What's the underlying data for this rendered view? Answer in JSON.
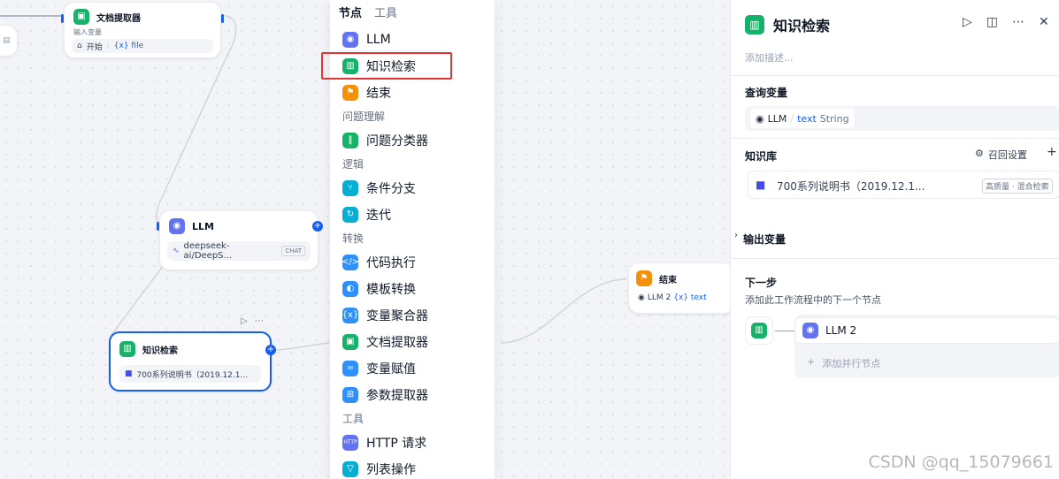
{
  "canvas": {
    "doc_extractor_node": {
      "title": "文档提取器",
      "subtitle": "输入变量",
      "input_source": "开始",
      "input_var": "{x} file"
    },
    "llm_node": {
      "title": "LLM",
      "model": "deepseek-ai/DeepS...",
      "badge": "CHAT"
    },
    "knowledge_node": {
      "title": "知识检索",
      "dataset": "700系列说明书（2019.12.1..."
    },
    "end_node": {
      "title": "结束",
      "source": "LLM 2",
      "var": "{x} text"
    }
  },
  "menu": {
    "tabs": [
      "节点",
      "工具"
    ],
    "items_top": [
      {
        "label": "LLM",
        "icon": "brain-icon"
      },
      {
        "label": "知识检索",
        "icon": "book-icon"
      },
      {
        "label": "结束",
        "icon": "flag-icon"
      }
    ],
    "cat_understanding": "问题理解",
    "items_understanding": [
      {
        "label": "问题分类器",
        "icon": "classifier-icon"
      }
    ],
    "cat_logic": "逻辑",
    "items_logic": [
      {
        "label": "条件分支",
        "icon": "branch-icon"
      },
      {
        "label": "迭代",
        "icon": "loop-icon"
      }
    ],
    "cat_transform": "转换",
    "items_transform": [
      {
        "label": "代码执行",
        "icon": "code-icon"
      },
      {
        "label": "模板转换",
        "icon": "template-icon"
      },
      {
        "label": "变量聚合器",
        "icon": "aggregator-icon"
      },
      {
        "label": "文档提取器",
        "icon": "doc-icon"
      },
      {
        "label": "变量赋值",
        "icon": "assign-icon"
      },
      {
        "label": "参数提取器",
        "icon": "param-icon"
      }
    ],
    "cat_tools": "工具",
    "items_tools": [
      {
        "label": "HTTP 请求",
        "icon": "http-icon"
      },
      {
        "label": "列表操作",
        "icon": "filter-icon"
      }
    ]
  },
  "panel": {
    "title": "知识检索",
    "description_placeholder": "添加描述...",
    "query_label": "查询变量",
    "query_source": "LLM",
    "query_var": "text",
    "query_type": "String",
    "kb_label": "知识库",
    "recall_settings": "召回设置",
    "kb_item": "700系列说明书（2019.12.1...",
    "kb_tag": "高质量 · 混合检索",
    "output_label": "输出变量",
    "next_label": "下一步",
    "next_desc": "添加此工作流程中的下一个节点",
    "next_node": "LLM 2",
    "add_parallel": "添加并行节点"
  },
  "watermark": "CSDN @qq_15079661"
}
